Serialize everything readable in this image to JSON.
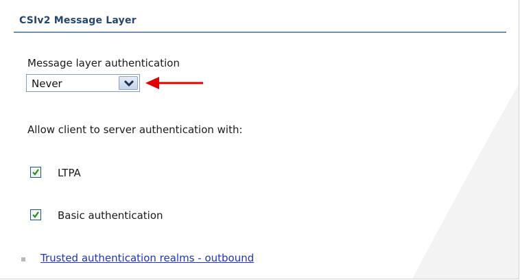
{
  "section": {
    "title": "CSIv2 Message Layer"
  },
  "message_layer": {
    "label": "Message layer authentication",
    "selected": "Never"
  },
  "client_auth": {
    "label": "Allow client to server authentication with:",
    "options": [
      {
        "label": "LTPA",
        "checked": true
      },
      {
        "label": "Basic authentication",
        "checked": true
      }
    ]
  },
  "links": {
    "trusted_realms": "Trusted authentication realms - outbound"
  },
  "colors": {
    "header_text": "#24466e",
    "header_rule": "#6d8fb5",
    "link": "#1a33c8",
    "annotation_arrow": "#e00000",
    "checkmark": "#2a8a1e"
  }
}
